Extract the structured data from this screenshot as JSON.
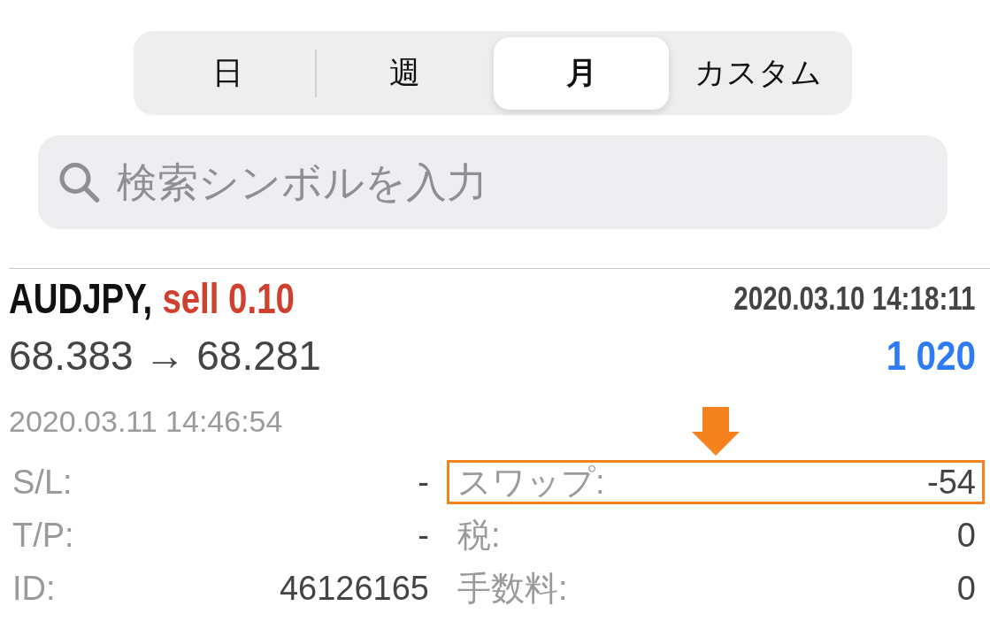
{
  "period_tabs": [
    {
      "label": "日",
      "selected": false
    },
    {
      "label": "週",
      "selected": false
    },
    {
      "label": "月",
      "selected": true
    },
    {
      "label": "カスタム",
      "selected": false
    }
  ],
  "search": {
    "placeholder": "検索シンボルを入力"
  },
  "trade": {
    "symbol": "AUDJPY,",
    "side": "sell 0.10",
    "open_time": "2020.03.10 14:18:11",
    "prices": "68.383 → 68.281",
    "profit": "1 020",
    "close_time": "2020.03.11 14:46:54",
    "details_left": [
      {
        "label": "S/L:",
        "value": "-"
      },
      {
        "label": "T/P:",
        "value": "-"
      },
      {
        "label": "ID:",
        "value": "46126165"
      }
    ],
    "details_right": [
      {
        "label": "スワップ:",
        "value": "-54",
        "highlighted": true
      },
      {
        "label": "税:",
        "value": "0",
        "highlighted": false
      },
      {
        "label": "手数料:",
        "value": "0",
        "highlighted": false
      }
    ]
  }
}
